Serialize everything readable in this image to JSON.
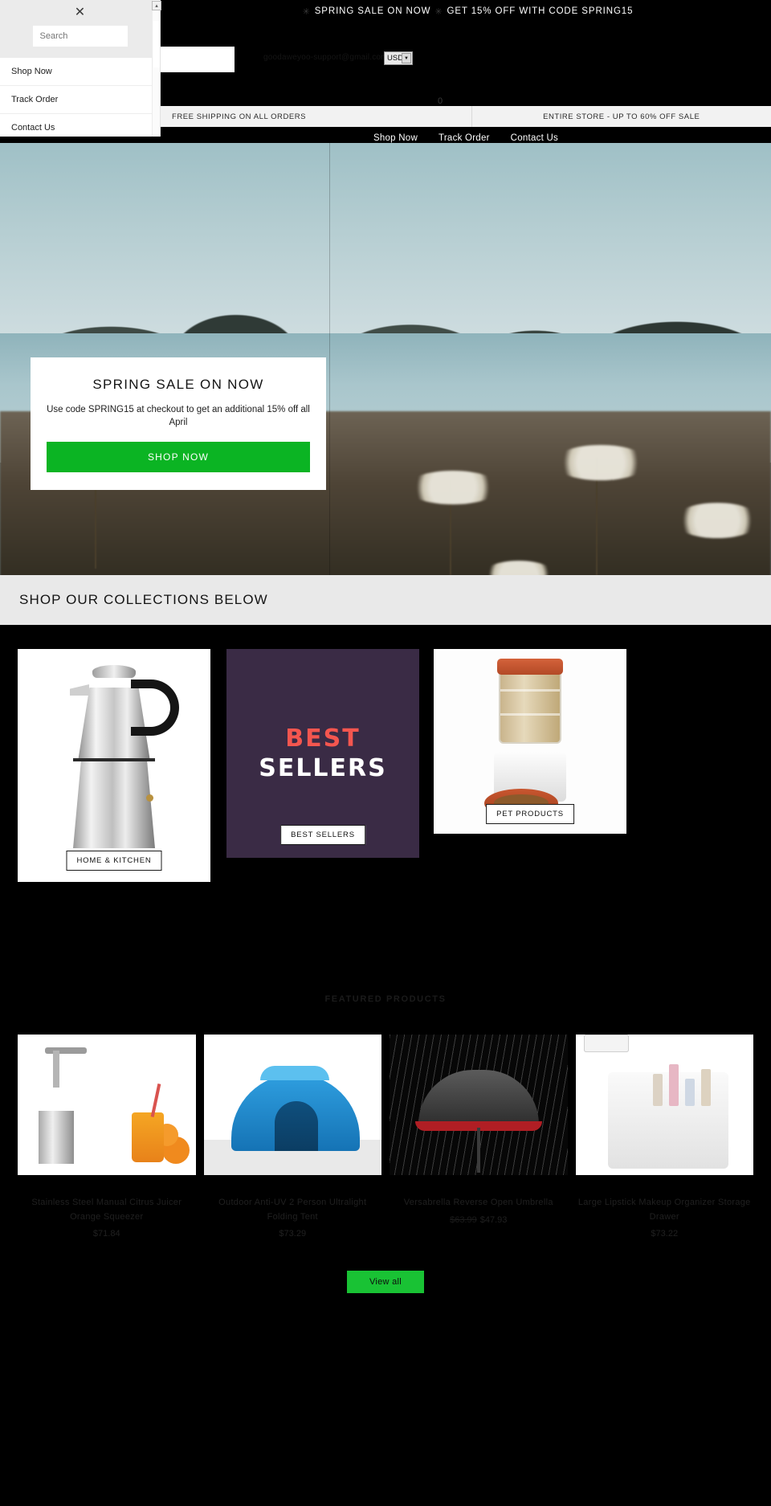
{
  "announcement": {
    "star": "✳",
    "text1": "SPRING SALE ON NOW",
    "text2": "GET 15% OFF WITH CODE SPRING15"
  },
  "header": {
    "email": "goodaweyoo-support@gmail.com",
    "currency_value": "USD",
    "currency_arrow": "▼",
    "cart_icon": "0"
  },
  "promo": {
    "left": "FREE SHIPPING ON ALL ORDERS",
    "right": "ENTIRE STORE - UP TO 60% OFF SALE"
  },
  "mainnav": {
    "items": [
      {
        "label": "Shop Now"
      },
      {
        "label": "Track Order"
      },
      {
        "label": "Contact Us"
      }
    ]
  },
  "drawer": {
    "close_glyph": "✕",
    "search_placeholder": "Search",
    "search_value": "",
    "links": [
      {
        "label": "Shop Now"
      },
      {
        "label": "Track Order"
      },
      {
        "label": "Contact Us"
      }
    ],
    "window_button": "▴"
  },
  "hero": {
    "title": "SPRING SALE ON NOW",
    "subtitle": "Use code SPRING15 at checkout to get an additional 15% off all April",
    "cta": "SHOP NOW"
  },
  "collections": {
    "heading": "SHOP OUR COLLECTIONS BELOW",
    "cards": [
      {
        "pill": "HOME & KITCHEN"
      },
      {
        "pill": "BEST SELLERS",
        "art_line1": "BEST",
        "art_line2": "SELLERS"
      },
      {
        "pill": "PET PRODUCTS"
      }
    ]
  },
  "featured": {
    "heading": "FEATURED PRODUCTS",
    "view_all": "View all",
    "products": [
      {
        "title": "Stainless Steel Manual Citrus Juicer Orange Squeezer",
        "price": "$71.84",
        "compare_price": ""
      },
      {
        "title": "Outdoor Anti-UV 2 Person Ultralight Folding Tent",
        "price": "$73.29",
        "compare_price": ""
      },
      {
        "title": "Versabrella Reverse Open Umbrella",
        "price": "$47.93",
        "compare_price": "$63.99"
      },
      {
        "title": "Large Lipstick Makeup Organizer Storage Drawer",
        "price": "$73.22",
        "compare_price": ""
      }
    ]
  },
  "colors": {
    "accent_green": "#0bb423",
    "best_sellers_bg": "#3a2b45",
    "best_sellers_red": "#f4564f"
  }
}
